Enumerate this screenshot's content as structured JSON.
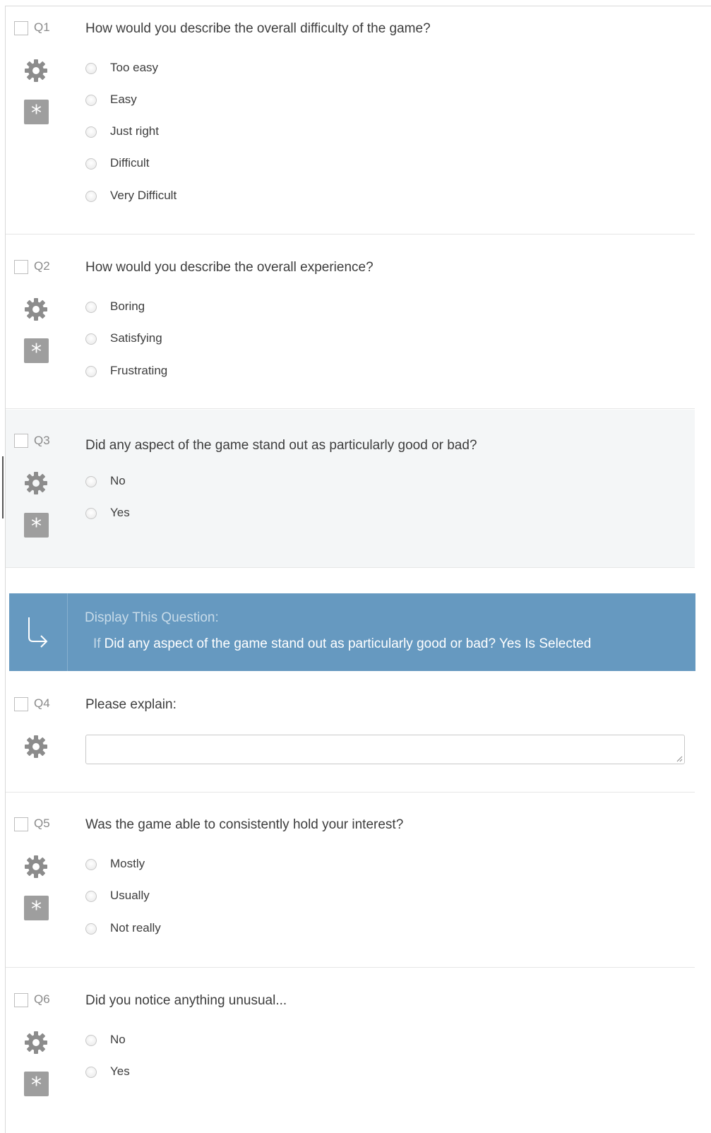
{
  "questions": [
    {
      "number": "Q1",
      "text": "How would you describe the overall difficulty of the game?",
      "required": true,
      "choices": [
        "Too easy",
        "Easy",
        "Just right",
        "Difficult",
        "Very Difficult"
      ]
    },
    {
      "number": "Q2",
      "text": "How would you describe the overall experience?",
      "required": true,
      "choices": [
        "Boring",
        "Satisfying",
        "Frustrating"
      ]
    },
    {
      "number": "Q3",
      "text": "Did any aspect of the game stand out as particularly good or bad?",
      "required": true,
      "choices": [
        "No",
        "Yes"
      ]
    },
    {
      "number": "Q4",
      "text": "Please explain:",
      "required": false,
      "textbox_value": ""
    },
    {
      "number": "Q5",
      "text": "Was the game able to consistently hold your interest?",
      "required": true,
      "choices": [
        "Mostly",
        "Usually",
        "Not really"
      ]
    },
    {
      "number": "Q6",
      "text": "Did you notice anything unusual...",
      "required": true,
      "choices": [
        "No",
        "Yes"
      ]
    }
  ],
  "display_logic": {
    "title": "Display This Question:",
    "if_word": "If",
    "condition": "Did any aspect of the game stand out as particularly good or bad? Yes Is Selected"
  },
  "icons": {
    "gear": "gear-icon",
    "required": "asterisk-icon",
    "logic": "branch-arrow-icon"
  },
  "colors": {
    "logic_bar": "#6699c0",
    "required_badge": "#9e9e9e",
    "gear": "#8c8c8c",
    "active_question_bg": "#f4f6f7"
  }
}
